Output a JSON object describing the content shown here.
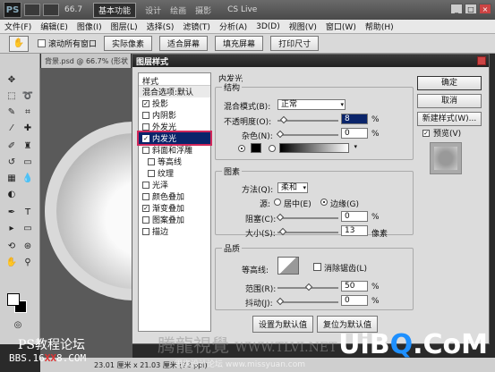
{
  "titlebar": {
    "logo": "PS",
    "zoom": "66.7",
    "workspace_active": "基本功能",
    "workspaces": [
      "设计",
      "绘画",
      "摄影"
    ],
    "cs_live": "CS Live"
  },
  "menubar": [
    "文件(F)",
    "编辑(E)",
    "图像(I)",
    "图层(L)",
    "选择(S)",
    "滤镜(T)",
    "分析(A)",
    "3D(D)",
    "视图(V)",
    "窗口(W)",
    "帮助(H)"
  ],
  "options": {
    "scroll_all_label": "滚动所有窗口",
    "actual_pixels": "实际像素",
    "fit_screen": "适合屏幕",
    "fill_screen": "填充屏幕",
    "print_size": "打印尺寸"
  },
  "doc_tab": "背景.psd @ 66.7% (形状",
  "status": "23.01 厘米 x 21.03 厘米 (72 ppi)",
  "dialog": {
    "title": "图层样式",
    "styles_header": "样式",
    "blend_options": "混合选项:默认",
    "items": [
      {
        "label": "投影",
        "checked": true,
        "sub": false
      },
      {
        "label": "内阴影",
        "checked": false,
        "sub": false
      },
      {
        "label": "外发光",
        "checked": false,
        "sub": false
      },
      {
        "label": "内发光",
        "checked": true,
        "sub": false,
        "active": true
      },
      {
        "label": "斜面和浮雕",
        "checked": false,
        "sub": false
      },
      {
        "label": "等高线",
        "checked": false,
        "sub": true
      },
      {
        "label": "纹理",
        "checked": false,
        "sub": true
      },
      {
        "label": "光泽",
        "checked": false,
        "sub": false
      },
      {
        "label": "颜色叠加",
        "checked": false,
        "sub": false
      },
      {
        "label": "渐变叠加",
        "checked": true,
        "sub": false
      },
      {
        "label": "图案叠加",
        "checked": false,
        "sub": false
      },
      {
        "label": "描边",
        "checked": false,
        "sub": false
      }
    ],
    "section_title": "内发光",
    "structure": {
      "title": "结构",
      "blend_mode_label": "混合模式(B):",
      "blend_mode_value": "正常",
      "opacity_label": "不透明度(O):",
      "opacity_value": "8",
      "noise_label": "杂色(N):",
      "noise_value": "0",
      "percent": "%"
    },
    "elements": {
      "title": "图素",
      "method_label": "方法(Q):",
      "method_value": "柔和",
      "source_label": "源:",
      "source_center": "居中(E)",
      "source_edge": "边缘(G)",
      "choke_label": "阻塞(C):",
      "choke_value": "0",
      "size_label": "大小(S):",
      "size_value": "13",
      "px": "像素",
      "percent": "%"
    },
    "quality": {
      "title": "品质",
      "contour_label": "等高线:",
      "antialias_label": "消除锯齿(L)",
      "range_label": "范围(R):",
      "range_value": "50",
      "jitter_label": "抖动(J):",
      "jitter_value": "0",
      "percent": "%"
    },
    "set_default": "设置为默认值",
    "reset_default": "复位为默认值",
    "ok": "确定",
    "cancel": "取消",
    "new_style": "新建样式(W)...",
    "preview": "预览(V)"
  },
  "watermarks": {
    "forum": "PS教程论坛",
    "bbs_prefix": "BBS.16",
    "bbs_x": "XX",
    "bbs_suffix": "8.COM",
    "brand_cn": "腾龍視覺",
    "brand_url": "WWW.TLVI.NET",
    "uibq_a": "UiB",
    "uibq_q": "Q",
    "uibq_b": ".CoM",
    "site_cn": "思缘设计论坛",
    "site_url": "www.missyuan.com"
  }
}
